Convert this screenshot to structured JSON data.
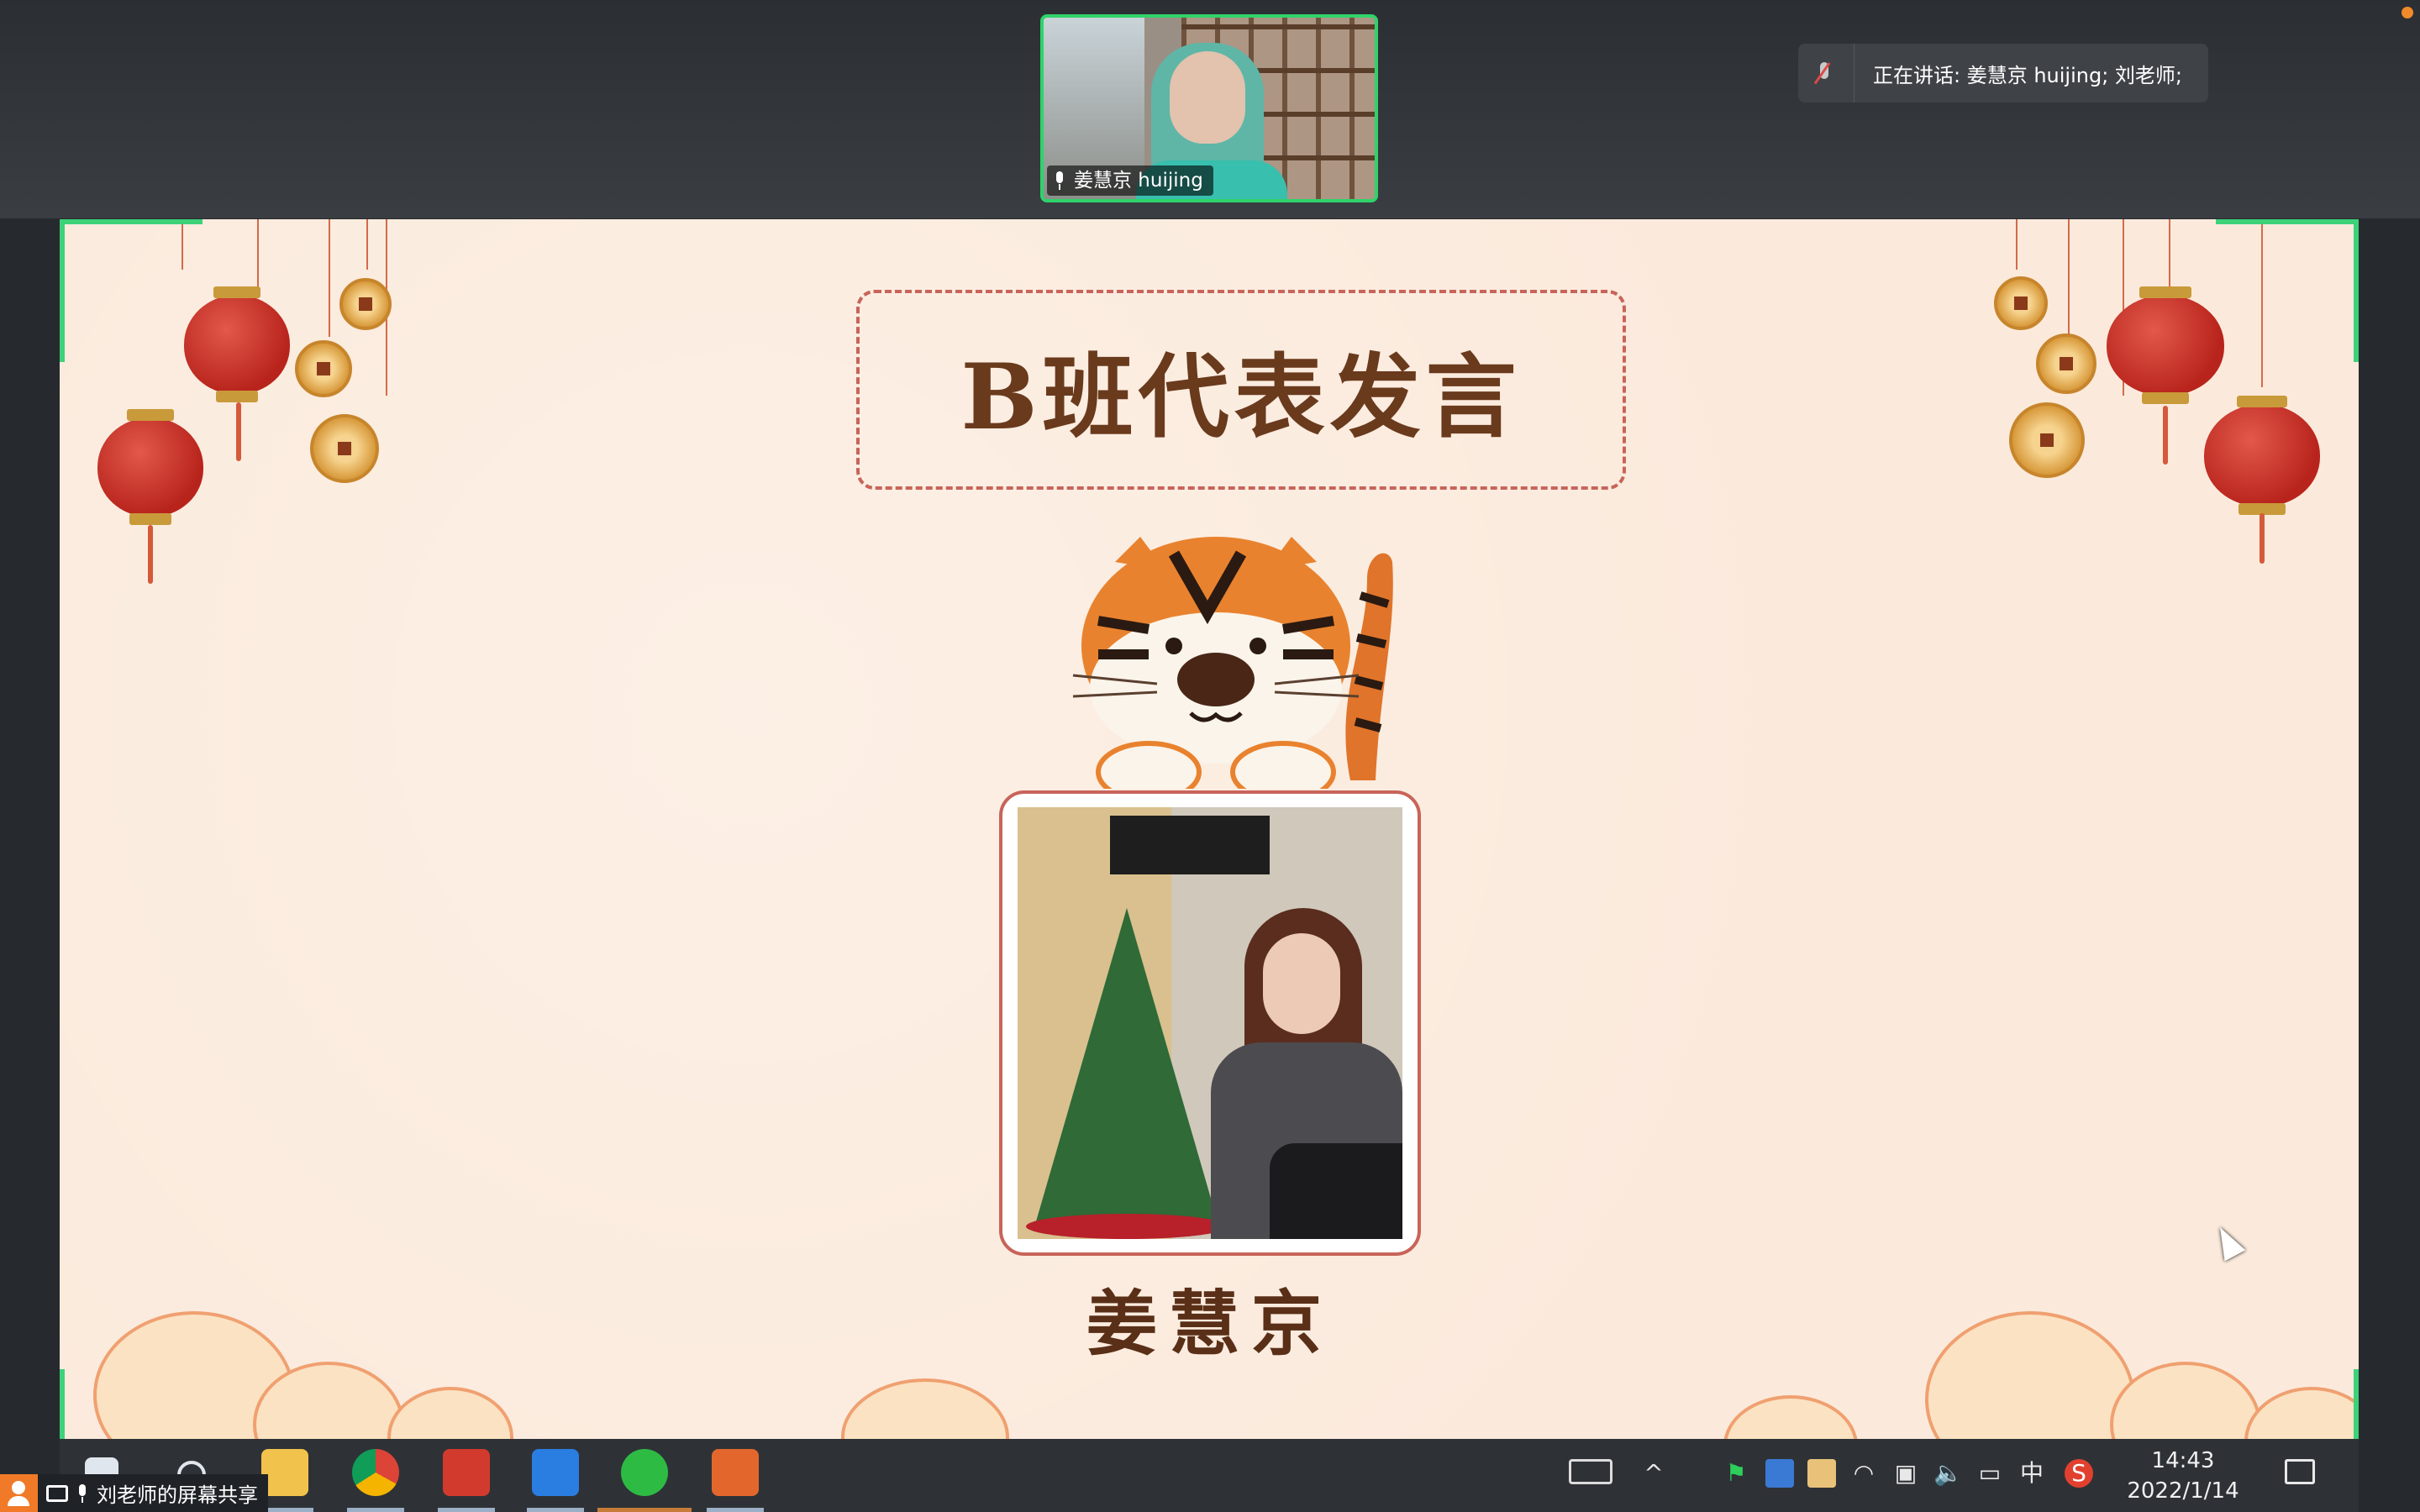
{
  "meeting": {
    "video_tile_name": "姜慧京 huijing",
    "speaking_label": "正在讲话: 姜慧京 huijing; 刘老师;",
    "screen_share_label": "刘老师的屏幕共享",
    "accent_color": "#2fd36a"
  },
  "slide": {
    "title": "B班代表发言",
    "speaker_name": "姜慧京"
  },
  "taskbar": {
    "apps": [
      "windows-start",
      "search",
      "file-explorer",
      "chrome",
      "wps-office",
      "lark",
      "wechat",
      "presentation"
    ],
    "tray": {
      "ime_label": "中",
      "time": "14:43",
      "date": "2022/1/14"
    }
  }
}
